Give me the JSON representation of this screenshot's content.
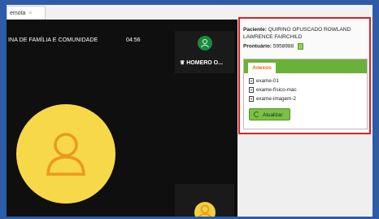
{
  "tab": {
    "label": "emota",
    "close": "×"
  },
  "meeting": {
    "title": "INA DE FAMÍLIA E COMUNIDADE",
    "timer": "04:56"
  },
  "participant": {
    "name": "HOMERO O..."
  },
  "patient": {
    "label": "Paciente:",
    "name_line1": "QUIRINO OFUSCADO ROWLAND",
    "name_line2": "LAWRENCE FAIRCHILD",
    "record_label": "Prontuário:",
    "record_number": "5958988"
  },
  "attachments": {
    "tab_label": "Anexos",
    "files": [
      "exame-01",
      "exame-físico-mac",
      "exame-imagem-2"
    ],
    "refresh_label": "Atualizar"
  },
  "colors": {
    "highlight_border": "#e02020",
    "accent_green": "#6ab13a",
    "avatar_yellow": "#f7d848",
    "tab_orange": "#e36b12"
  }
}
